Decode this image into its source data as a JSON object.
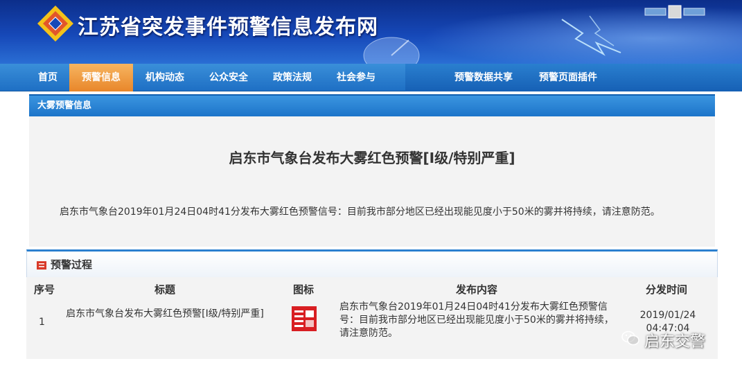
{
  "header": {
    "site_title": "江苏省突发事件预警信息发布网"
  },
  "nav": {
    "items": [
      {
        "label": "首页",
        "active": false
      },
      {
        "label": "预警信息",
        "active": true
      },
      {
        "label": "机构动态",
        "active": false
      },
      {
        "label": "公众安全",
        "active": false
      },
      {
        "label": "政策法规",
        "active": false
      },
      {
        "label": "社会参与",
        "active": false
      },
      {
        "label": "预警数据共享",
        "active": false
      },
      {
        "label": "预警页面插件",
        "active": false
      }
    ]
  },
  "section": {
    "label": "大雾预警信息"
  },
  "alert": {
    "title": "启东市气象台发布大雾红色预警[Ⅰ级/特别严重]",
    "body": "启东市气象台2019年01月24日04时41分发布大雾红色预警信号：目前我市部分地区已经出现能见度小于50米的雾并将持续，请注意防范。"
  },
  "process": {
    "title": "预警过程",
    "columns": [
      "序号",
      "标题",
      "图标",
      "发布内容",
      "分发时间"
    ],
    "rows": [
      {
        "index": "1",
        "title": "启东市气象台发布大雾红色预警[Ⅰ级/特别严重]",
        "icon_name": "fog-red-warning-icon",
        "content": "启东市气象台2019年01月24日04时41分发布大雾红色预警信号：目前我市部分地区已经出现能见度小于50米的雾并将持续，请注意防范。",
        "date": "2019/01/24",
        "time": "04:47:04"
      }
    ]
  },
  "watermark": {
    "text": "启东交警"
  },
  "colors": {
    "nav_blue": "#1e6fc4",
    "active_orange": "#e8862a",
    "warning_red": "#d81e22"
  }
}
